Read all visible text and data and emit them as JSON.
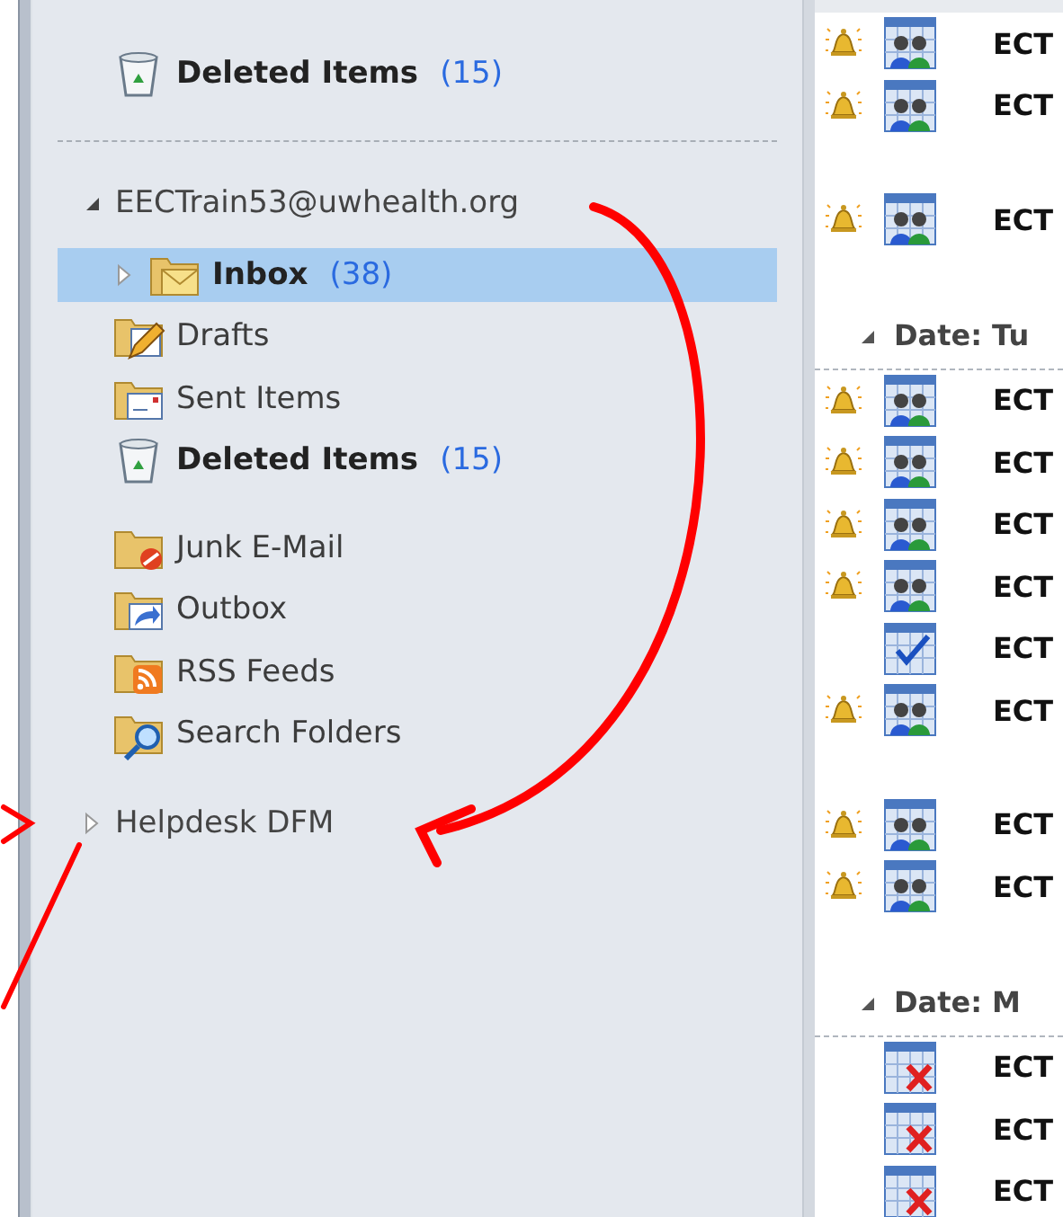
{
  "folder_pane": {
    "items": [
      {
        "label": "Deleted Items",
        "count": "(15)",
        "bold": true,
        "selected": false,
        "kind": "deleted"
      }
    ],
    "accounts": [
      {
        "name": "EECTrain53@uwhealth.org",
        "expanded": true,
        "groups": [
          [
            {
              "label": "Inbox",
              "count": "(38)",
              "bold": true,
              "selected": true,
              "expanded": false,
              "kind": "inbox"
            },
            {
              "label": "Drafts",
              "bold": false,
              "selected": false,
              "kind": "drafts"
            },
            {
              "label": "Sent Items",
              "bold": false,
              "selected": false,
              "kind": "sent"
            },
            {
              "label": "Deleted Items",
              "count": "(15)",
              "bold": true,
              "selected": false,
              "kind": "deleted"
            }
          ],
          [
            {
              "label": "Junk E-Mail",
              "bold": false,
              "selected": false,
              "kind": "junk"
            },
            {
              "label": "Outbox",
              "bold": false,
              "selected": false,
              "kind": "outbox"
            },
            {
              "label": "RSS Feeds",
              "bold": false,
              "selected": false,
              "kind": "rss"
            },
            {
              "label": "Search Folders",
              "bold": false,
              "selected": false,
              "kind": "search"
            }
          ]
        ]
      },
      {
        "name": "Helpdesk DFM",
        "expanded": false
      }
    ]
  },
  "message_list": {
    "items": [
      {
        "kind": "meeting",
        "reminder": true,
        "subject": "ECT"
      },
      {
        "kind": "meeting",
        "reminder": true,
        "subject": "ECT"
      },
      {
        "kind": "spacer"
      },
      {
        "kind": "meeting",
        "reminder": true,
        "subject": "ECT"
      },
      {
        "kind": "spacer"
      },
      {
        "kind": "header",
        "label": "Date: Tu",
        "expanded": true
      },
      {
        "kind": "meeting",
        "reminder": true,
        "subject": "ECT"
      },
      {
        "kind": "meeting",
        "reminder": true,
        "subject": "ECT"
      },
      {
        "kind": "meeting",
        "reminder": true,
        "subject": "ECT"
      },
      {
        "kind": "meeting",
        "reminder": true,
        "subject": "ECT"
      },
      {
        "kind": "task",
        "reminder": false,
        "subject": "ECT"
      },
      {
        "kind": "meeting",
        "reminder": true,
        "subject": "ECT"
      },
      {
        "kind": "spacer"
      },
      {
        "kind": "meeting",
        "reminder": true,
        "subject": "ECT"
      },
      {
        "kind": "meeting",
        "reminder": true,
        "subject": "ECT"
      },
      {
        "kind": "spacer"
      },
      {
        "kind": "header",
        "label": "Date: M",
        "expanded": true
      },
      {
        "kind": "cancelled",
        "reminder": false,
        "subject": "ECT"
      },
      {
        "kind": "cancelled",
        "reminder": false,
        "subject": "ECT"
      },
      {
        "kind": "cancelled",
        "reminder": false,
        "subject": "ECT"
      }
    ]
  }
}
